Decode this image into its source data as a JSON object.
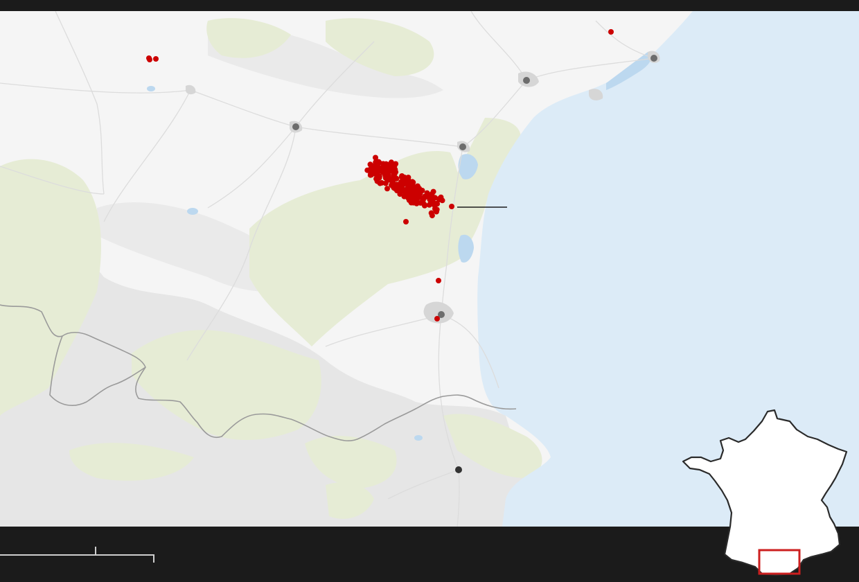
{
  "map": {
    "colors": {
      "frame": "#1b1b1b",
      "land": "#f5f5f5",
      "sea": "#dcebf7",
      "forest": "#e6ecd5",
      "relief": "#d8d8d8",
      "urban": "#d6d6d6",
      "roads": "#dcdcdc",
      "lakes": "#bcd8ef",
      "border": "#9a9a9a",
      "city_marker": "#6d6d6d",
      "capital_marker": "#333333",
      "fire_point": "#cc0000",
      "leader_line": "#1b1b1b",
      "scale_bar": "#cfcfcf"
    },
    "layers": [
      "land",
      "forest",
      "relief",
      "roads",
      "lakes",
      "border",
      "cities",
      "fire-points",
      "leader-line",
      "scale-bar"
    ],
    "city_marker_icon": "circle-marker",
    "fire_point_icon": "red-dot-marker",
    "fire_cluster": {
      "description_shown": false
    },
    "inset": {
      "country": "France",
      "highlight_color": "#cc1f1f",
      "fill": "#ffffff",
      "stroke": "#2a2a2a"
    }
  }
}
